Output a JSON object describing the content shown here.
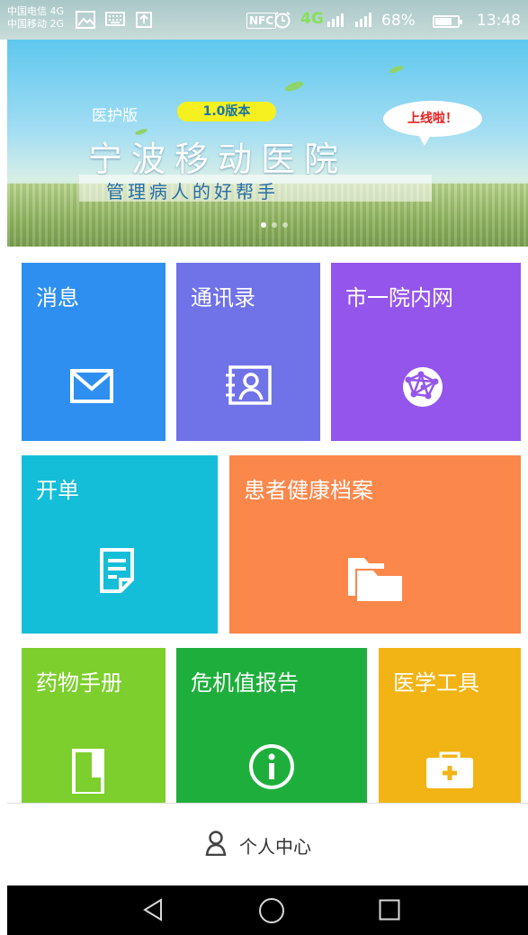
{
  "status_bar": {
    "carrier_1": "中国电信 4G",
    "carrier_2": "中国移动 2G",
    "nfc": "NFC",
    "network": "4G",
    "battery": "68%",
    "battery_level": 0.68,
    "time": "13:48"
  },
  "banner": {
    "edition": "医护版",
    "version": "1.0版本",
    "bubble": "上线啦！",
    "title": "宁波移动医院",
    "subtitle": "管理病人的好帮手",
    "pages": 3,
    "active_page": 1
  },
  "tiles": {
    "messages": {
      "label": "消息",
      "color": "#2e8ff0",
      "icon": "mail-icon"
    },
    "contacts": {
      "label": "通讯录",
      "color": "#7072e8",
      "icon": "contact-card-icon"
    },
    "intranet": {
      "label": "市一院内网",
      "color": "#9455ec",
      "icon": "network-globe-icon"
    },
    "order": {
      "label": "开单",
      "color": "#14bed8",
      "icon": "document-icon"
    },
    "health_records": {
      "label": "患者健康档案",
      "color": "#fb874a",
      "icon": "folder-icon"
    },
    "drug_manual": {
      "label": "药物手册",
      "color": "#7ccf2c",
      "icon": "book-icon"
    },
    "critical_report": {
      "label": "危机值报告",
      "color": "#1eae3c",
      "icon": "info-icon"
    },
    "medical_tools": {
      "label": "医学工具",
      "color": "#f2b315",
      "icon": "medical-kit-icon"
    }
  },
  "tab_bar": {
    "personal_center": "个人中心",
    "icon": "person-icon"
  },
  "nav_bar": {
    "back": "back-icon",
    "home": "home-icon",
    "recents": "recents-icon"
  }
}
